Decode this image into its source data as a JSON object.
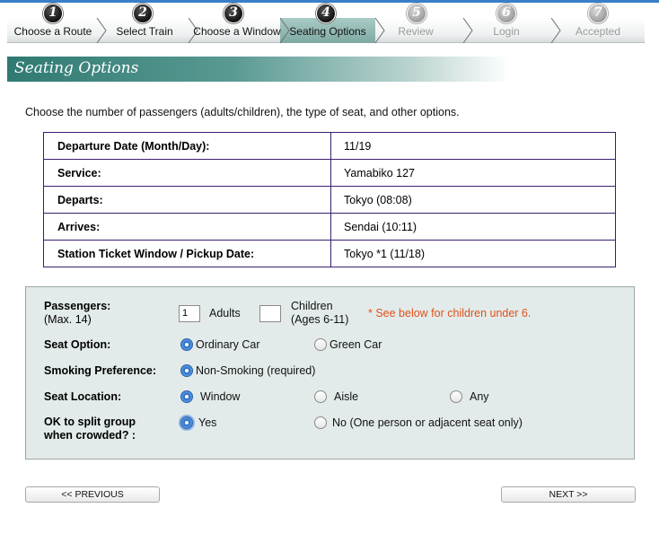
{
  "steps": [
    {
      "num": "1",
      "label": "Choose a Route",
      "state": "done"
    },
    {
      "num": "2",
      "label": "Select Train",
      "state": "done"
    },
    {
      "num": "3",
      "label": "Choose a  Window",
      "state": "done"
    },
    {
      "num": "4",
      "label": "Seating Options",
      "state": "active"
    },
    {
      "num": "5",
      "label": "Review",
      "state": "pending"
    },
    {
      "num": "6",
      "label": "Login",
      "state": "pending"
    },
    {
      "num": "7",
      "label": "Accepted",
      "state": "pending"
    }
  ],
  "section_title": "Seating Options",
  "intro": "Choose the number of passengers (adults/children), the type of seat, and other options.",
  "trip": [
    {
      "label": "Departure Date (Month/Day):",
      "value": "11/19"
    },
    {
      "label": "Service:",
      "value": "Yamabiko 127"
    },
    {
      "label": "Departs:",
      "value": "Tokyo (08:08)"
    },
    {
      "label": "Arrives:",
      "value": "Sendai (10:11)"
    },
    {
      "label": "Station Ticket Window / Pickup Date:",
      "value": "Tokyo *1 (11/18)"
    }
  ],
  "options": {
    "passengers": {
      "label": "Passengers:",
      "sublabel": "(Max. 14)",
      "adults_value": "1",
      "adults_label": "Adults",
      "children_value": "",
      "children_label": "Children",
      "children_sublabel": "(Ages 6-11)",
      "note": "* See below for children under 6."
    },
    "seat_option": {
      "label": "Seat Option:",
      "choices": [
        "Ordinary Car",
        "Green Car"
      ],
      "selected": "Ordinary Car"
    },
    "smoking": {
      "label": "Smoking Preference:",
      "choices": [
        "Non-Smoking (required)"
      ],
      "selected": "Non-Smoking (required)"
    },
    "seat_location": {
      "label": "Seat Location:",
      "choices": [
        "Window",
        "Aisle",
        "Any"
      ],
      "selected": "Window"
    },
    "split_group": {
      "label_line1": "OK to split group",
      "label_line2": "when crowded? :",
      "choices": [
        "Yes",
        "No (One person or adjacent seat only)"
      ],
      "selected": "Yes"
    }
  },
  "nav": {
    "previous": "<< PREVIOUS",
    "next": "NEXT >>"
  },
  "colors": {
    "header_teal": "#2f7a72",
    "note_orange": "#e0511b",
    "table_border": "#3a1f6e",
    "options_bg": "#e3ebea"
  }
}
